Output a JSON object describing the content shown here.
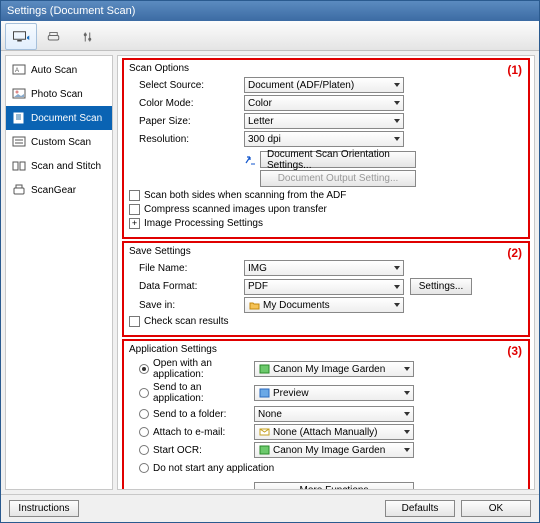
{
  "window": {
    "title": "Settings (Document Scan)"
  },
  "sidebar": {
    "items": [
      {
        "label": "Auto Scan"
      },
      {
        "label": "Photo Scan"
      },
      {
        "label": "Document Scan"
      },
      {
        "label": "Custom Scan"
      },
      {
        "label": "Scan and Stitch"
      },
      {
        "label": "ScanGear"
      }
    ],
    "selected_index": 2
  },
  "section1": {
    "num": "(1)",
    "title": "Scan Options",
    "select_source_label": "Select Source:",
    "select_source_value": "Document (ADF/Platen)",
    "color_mode_label": "Color Mode:",
    "color_mode_value": "Color",
    "paper_size_label": "Paper Size:",
    "paper_size_value": "Letter",
    "resolution_label": "Resolution:",
    "resolution_value": "300 dpi",
    "orientation_btn": "Document Scan Orientation Settings...",
    "output_btn": "Document Output Setting...",
    "cb_scan_both": "Scan both sides when scanning from the ADF",
    "cb_compress": "Compress scanned images upon transfer",
    "img_proc": "Image Processing Settings"
  },
  "section2": {
    "num": "(2)",
    "title": "Save Settings",
    "file_name_label": "File Name:",
    "file_name_value": "IMG",
    "data_format_label": "Data Format:",
    "data_format_value": "PDF",
    "settings_btn": "Settings...",
    "save_in_label": "Save in:",
    "save_in_value": "My Documents",
    "cb_check": "Check scan results"
  },
  "section3": {
    "num": "(3)",
    "title": "Application Settings",
    "open_app_label": "Open with an application:",
    "open_app_value": "Canon My Image Garden",
    "send_app_label": "Send to an application:",
    "send_app_value": "Preview",
    "send_folder_label": "Send to a folder:",
    "send_folder_value": "None",
    "attach_label": "Attach to e-mail:",
    "attach_value": "None (Attach Manually)",
    "ocr_label": "Start OCR:",
    "ocr_value": "Canon My Image Garden",
    "none_label": "Do not start any application",
    "more_btn": "More Functions"
  },
  "footer": {
    "instructions": "Instructions",
    "defaults": "Defaults",
    "ok": "OK"
  }
}
